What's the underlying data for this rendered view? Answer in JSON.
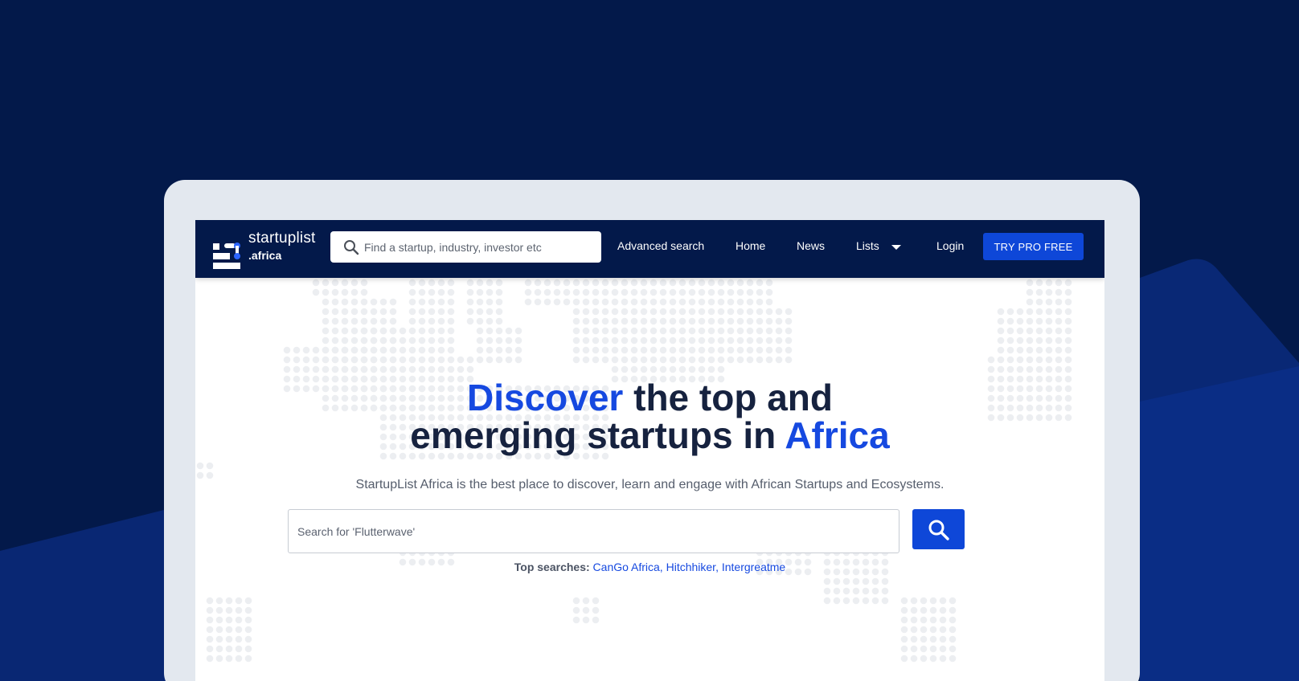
{
  "logo": {
    "word": "startuplist",
    "tld": ".africa"
  },
  "nav": {
    "search_placeholder": "Find a startup, industry, investor etc",
    "advanced_search": "Advanced search",
    "home": "Home",
    "news": "News",
    "lists": "Lists",
    "login": "Login",
    "cta": "TRY PRO FREE"
  },
  "hero": {
    "headline_accent_1": "Discover",
    "headline_part_1": " the top and",
    "headline_part_2": "emerging startups in ",
    "headline_accent_2": "Africa",
    "subline": "StartupList Africa is the best place to discover, learn and engage with African Startups and Ecosystems.",
    "search_placeholder": "Search for 'Flutterwave'",
    "top_searches_label": "Top searches:",
    "top_searches": [
      "CanGo Africa,",
      "Hitchhiker,",
      "Intergreatme"
    ]
  },
  "colors": {
    "background": "#03194a",
    "accent": "#1649e0",
    "button": "#0e47d8",
    "headline": "#16223f"
  },
  "icons": {
    "nav_search": "search-icon",
    "main_search": "search-icon",
    "lists_caret": "caret-down-icon"
  }
}
